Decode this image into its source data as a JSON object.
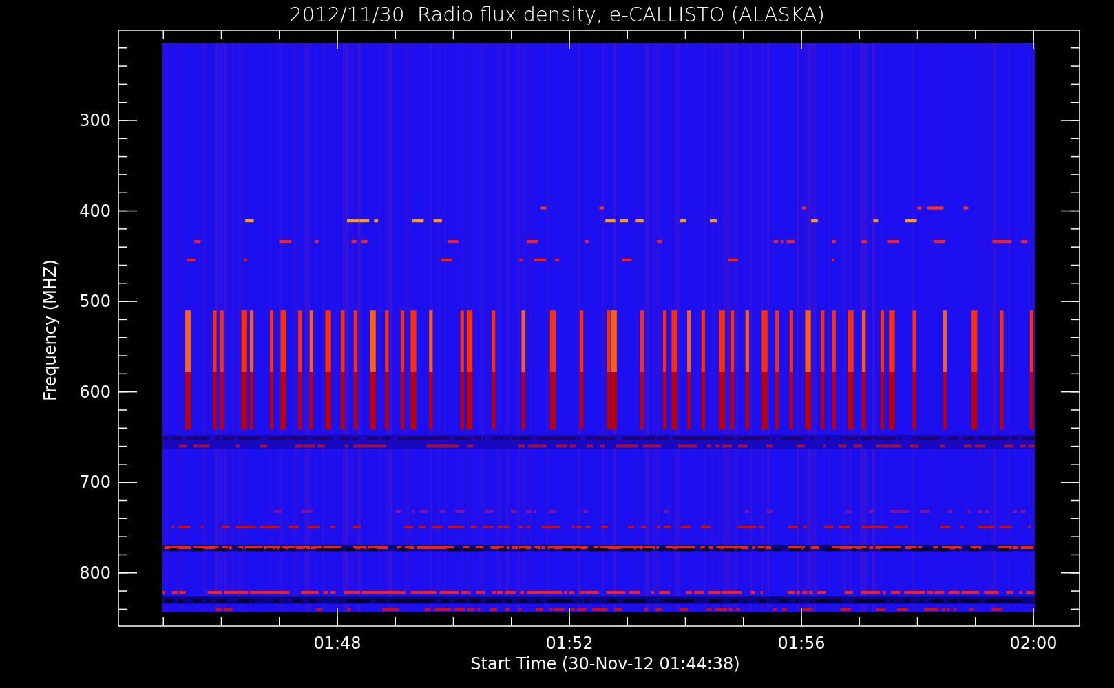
{
  "title": "2012/11/30  Radio flux density, e-CALLISTO (ALASKA)",
  "y_axis": {
    "label": "Frequency (MHZ)",
    "ticks": [
      "300",
      "400",
      "500",
      "600",
      "700",
      "800"
    ]
  },
  "x_axis": {
    "label": "Start Time (30-Nov-12 01:44:38)",
    "ticks": [
      "01:48",
      "01:52",
      "01:56",
      "02:00"
    ]
  }
}
